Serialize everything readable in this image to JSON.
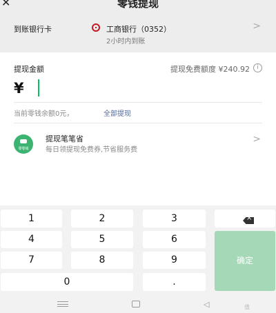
{
  "header": {
    "title": "零钱提现",
    "back_icon": "close-icon",
    "more_label": "···"
  },
  "bank": {
    "label": "到账银行卡",
    "name": "工商银行（0352）",
    "arrival": "2小时内到账",
    "icon": "icbc-logo-icon",
    "brand_color": "#c7161e"
  },
  "amount": {
    "label": "提现金额",
    "quota": "提现免费额度 ¥240.92",
    "currency": "¥",
    "value": "",
    "balance_text": "当前零钱余额0元，",
    "withdraw_all": "全部提现"
  },
  "promo": {
    "icon_text": "零零钱",
    "title": "提现笔笔省",
    "subtitle": "每日领提现免费券,节省服务费"
  },
  "keypad": {
    "keys": [
      "1",
      "2",
      "3",
      "4",
      "5",
      "6",
      "7",
      "8",
      "9",
      "0",
      "."
    ],
    "confirm": "确定",
    "confirm_color": "#a5d8b6",
    "cursor_color": "#07c160"
  },
  "navbar": {
    "watermark": "值"
  }
}
